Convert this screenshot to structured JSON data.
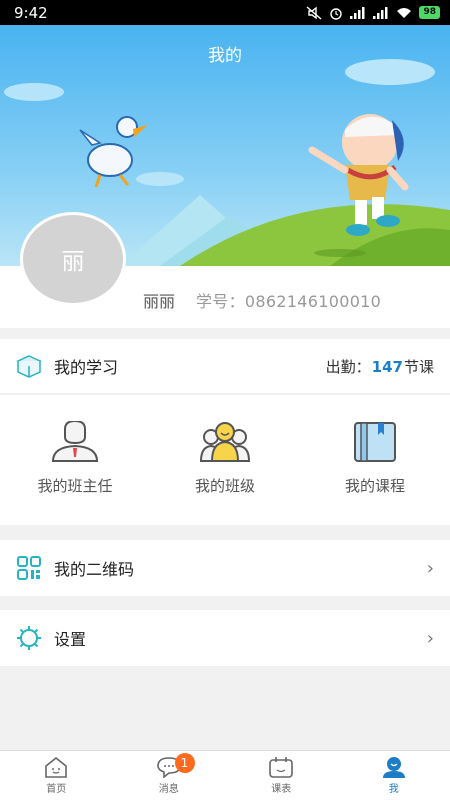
{
  "status_bar": {
    "time": "9:42",
    "battery": "98"
  },
  "header": {
    "title": "我的"
  },
  "profile": {
    "avatar_text": "丽",
    "name": "丽丽",
    "student_id": "学号：0862146100010"
  },
  "study": {
    "title": "我的学习",
    "attendance_prefix": "出勤：",
    "attendance_count": "147",
    "attendance_suffix": "节课"
  },
  "shortcuts": [
    {
      "label": "我的班主任",
      "icon": "head-teacher-icon"
    },
    {
      "label": "我的班级",
      "icon": "class-icon"
    },
    {
      "label": "我的课程",
      "icon": "course-book-icon"
    }
  ],
  "menu": {
    "qrcode": {
      "label": "我的二维码",
      "icon": "qrcode-icon"
    },
    "settings": {
      "label": "设置",
      "icon": "settings-icon"
    }
  },
  "tabs": [
    {
      "label": "首页",
      "icon": "home-icon"
    },
    {
      "label": "消息",
      "icon": "message-icon",
      "badge": "1"
    },
    {
      "label": "课表",
      "icon": "calendar-icon"
    },
    {
      "label": "我",
      "icon": "user-icon",
      "active": true
    }
  ],
  "colors": {
    "accent": "#1b7ec6",
    "badge": "#ff6a1f",
    "teal_icon": "#26b3c4",
    "hero_sky": "#49b3f0"
  }
}
